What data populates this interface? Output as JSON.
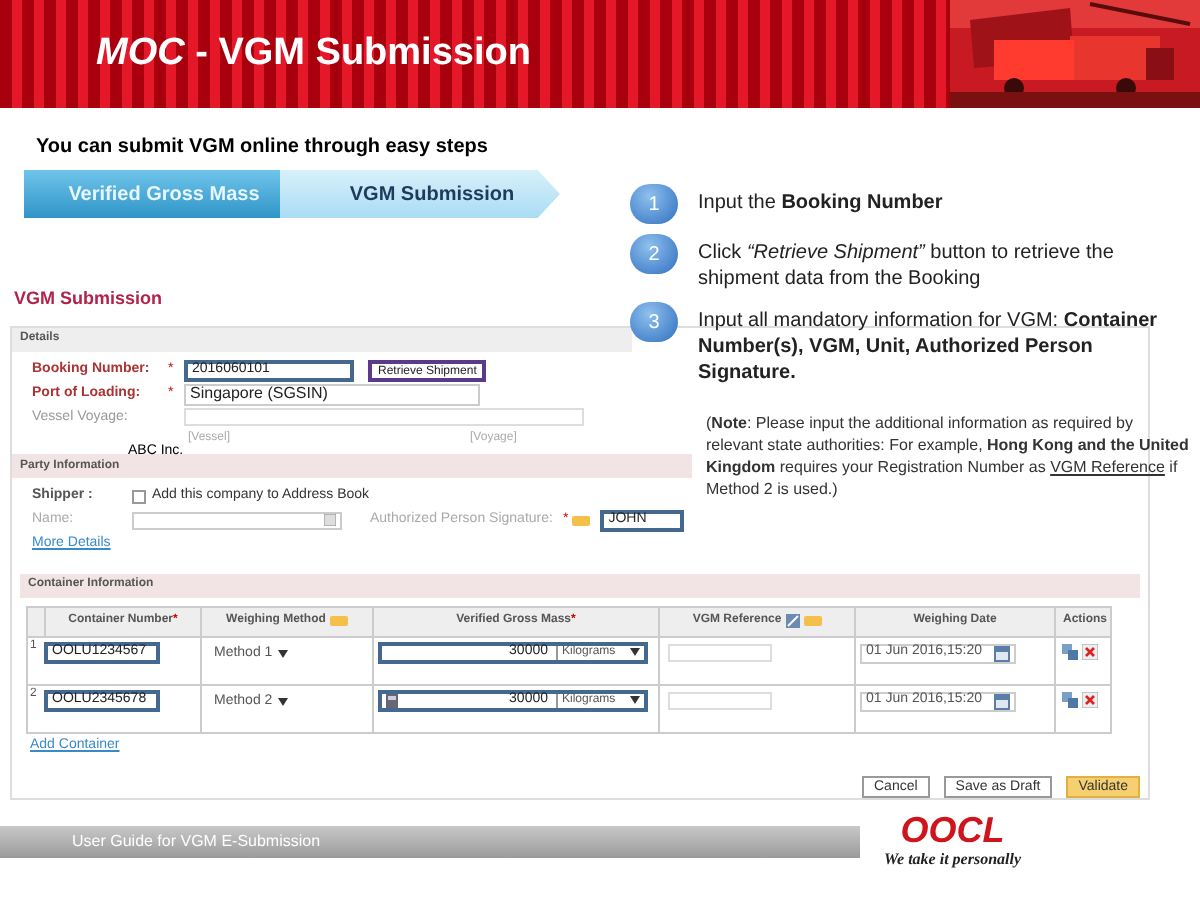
{
  "header": {
    "title": "*MOC* - VGM Submission"
  },
  "intro": "You can submit VGM online through easy steps",
  "process": [
    {
      "label": "Verified Gross Mass",
      "selected": false
    },
    {
      "label": "VGM Submission",
      "selected": true
    }
  ],
  "steps": [
    {
      "number": "1",
      "text": "Input the **Booking Number**"
    },
    {
      "number": "2",
      "text": "Click *“Retrieve Shipment”* button to retrieve the shipment data from the Booking"
    },
    {
      "number": "3",
      "text": "Input all mandatory information for VGM: **Container Number(s), VGM, Unit, Authorized Person Signature.**"
    }
  ],
  "note": {
    "text": "(**Note**: Please input the additional information  as required by relevant state authorities: For example, **Hong Kong  and the United Kingdom** requires your Registration Number as",
    "link": "VGM Reference",
    "after": "if Method 2 is used.)"
  },
  "form": {
    "title": "VGM Submission",
    "details": {
      "legend": "Details",
      "booking_label": "Booking Number:",
      "booking_required": "*",
      "port_required": "*",
      "booking_value": "2016060101",
      "retrieve_button": "Retrieve Shipment",
      "port_label": "Port of Loading:",
      "port_value": "Singapore (SGSIN)",
      "vessel_label": "Vessel Voyage:",
      "vessel_hint": "[Vessel]",
      "voyage_hint": "[Voyage]"
    },
    "party": {
      "legend": "Party Information",
      "annotation": "ABC Inc.",
      "shipper_label": "Shipper :",
      "address_book": {
        "label": "Add this company to Address Book",
        "checked": false
      },
      "name_label": "Name:",
      "signature_label": "Authorized Person Signature:",
      "signature_required": "*",
      "signature_value": "JOHN",
      "more_details": "More Details"
    },
    "container": {
      "legend": "Container Information",
      "columns": [
        {
          "label": "Container Number",
          "required_mark": "*",
          "tip": false,
          "edit": false
        },
        {
          "label": "Weighing Method",
          "tip": true,
          "edit": false
        },
        {
          "label": "Verified Gross Mass",
          "required_mark": "*",
          "tip": false,
          "edit": false
        },
        {
          "label": "VGM Reference",
          "tip": true,
          "edit": true
        },
        {
          "label": "Weighing Date",
          "tip": false,
          "edit": false
        },
        {
          "label": "Actions",
          "tip": false,
          "edit": false
        }
      ],
      "rows": [
        {
          "index": "1",
          "container": "OOLU1234567",
          "method": "Method 1",
          "vgm": "30000",
          "unit": "Kilograms",
          "calculator": false,
          "date": "01 Jun 2016,15:20"
        },
        {
          "index": "2",
          "container": "OOLU2345678",
          "method": "Method 2",
          "vgm": "30000",
          "unit": "Kilograms",
          "calculator": true,
          "date": "01 Jun 2016,15:20"
        }
      ],
      "add_link": "Add Container"
    },
    "buttons": [
      {
        "label": "Cancel",
        "kind": "plain"
      },
      {
        "label": "Save as Draft",
        "kind": "plain"
      },
      {
        "label": "Validate",
        "kind": "primary"
      }
    ]
  },
  "footer": {
    "guide": "User Guide for VGM E-Submission",
    "logo": "OOCL",
    "tagline": "We take it personally"
  }
}
